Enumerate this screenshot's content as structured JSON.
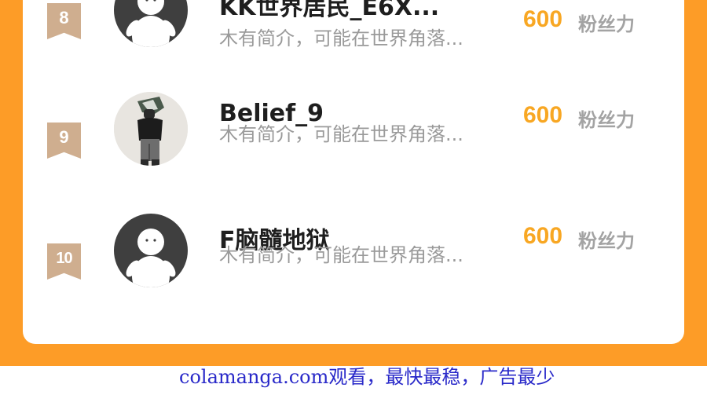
{
  "ranking": {
    "entries": [
      {
        "rank": "8",
        "name": "KK世界居民_E6X...",
        "bio": "木有简介，可能在世界角落...",
        "fans_value": "600",
        "fans_label": "粉丝力",
        "avatar": "default-avatar-icon"
      },
      {
        "rank": "9",
        "name": "Belief_9",
        "bio": "木有简介，可能在世界角落...",
        "fans_value": "600",
        "fans_label": "粉丝力",
        "avatar": "user-photo"
      },
      {
        "rank": "10",
        "name": "F脑髓地狱",
        "bio": "木有简介，可能在世界角落...",
        "fans_value": "600",
        "fans_label": "粉丝力",
        "avatar": "default-avatar-icon"
      }
    ]
  },
  "watermark": "colamanga.com观看，最快最稳，广告最少",
  "colors": {
    "background": "#fd9c27",
    "card": "#ffffff",
    "rank_badge": "#cfae8f",
    "fans_value": "#f8a723",
    "watermark": "#2929c9"
  }
}
